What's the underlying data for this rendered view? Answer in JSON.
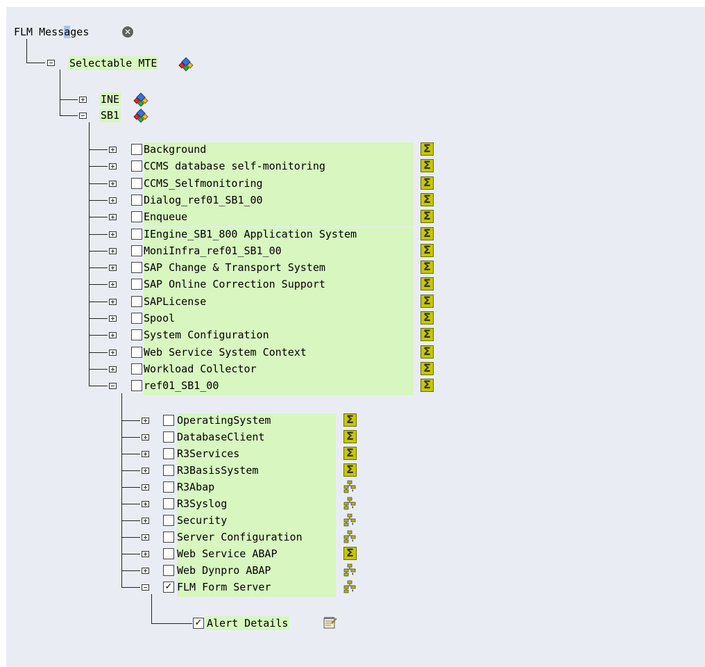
{
  "root": {
    "title_before": "FLM Mess",
    "title_sel": "a",
    "title_after": "ges"
  },
  "level1": {
    "label": "Selectable MTE"
  },
  "systems": [
    {
      "label": "INE"
    },
    {
      "label": "SB1"
    }
  ],
  "sb1_items": [
    {
      "label": "Background",
      "checked": false,
      "icon": "sigma-icon"
    },
    {
      "label": "CCMS database self-monitoring",
      "checked": false,
      "icon": "sigma-icon"
    },
    {
      "label": "CCMS_Selfmonitoring",
      "checked": false,
      "icon": "sigma-icon"
    },
    {
      "label": "Dialog_ref01_SB1_00",
      "checked": false,
      "icon": "sigma-icon"
    },
    {
      "label": "Enqueue",
      "checked": false,
      "icon": "sigma-icon"
    },
    {
      "label": "IEngine_SB1_800 Application System",
      "checked": false,
      "icon": "sigma-icon"
    },
    {
      "label": "MoniInfra_ref01_SB1_00",
      "checked": false,
      "icon": "sigma-icon"
    },
    {
      "label": "SAP Change & Transport System",
      "checked": false,
      "icon": "sigma-icon"
    },
    {
      "label": "SAP Online Correction Support",
      "checked": false,
      "icon": "sigma-icon"
    },
    {
      "label": "SAPLicense",
      "checked": false,
      "icon": "sigma-icon"
    },
    {
      "label": "Spool",
      "checked": false,
      "icon": "sigma-icon"
    },
    {
      "label": "System Configuration",
      "checked": false,
      "icon": "sigma-icon"
    },
    {
      "label": "Web Service System Context",
      "checked": false,
      "icon": "sigma-icon"
    },
    {
      "label": "Workload Collector",
      "checked": false,
      "icon": "sigma-icon"
    },
    {
      "label": "ref01_SB1_00",
      "checked": false,
      "icon": "sigma-icon"
    }
  ],
  "ref_items": [
    {
      "label": "OperatingSystem",
      "checked": false,
      "icon": "sigma-icon"
    },
    {
      "label": "DatabaseClient",
      "checked": false,
      "icon": "sigma-icon"
    },
    {
      "label": "R3Services",
      "checked": false,
      "icon": "sigma-icon"
    },
    {
      "label": "R3BasisSystem",
      "checked": false,
      "icon": "sigma-icon"
    },
    {
      "label": "R3Abap",
      "checked": false,
      "icon": "collection-tree-icon"
    },
    {
      "label": "R3Syslog",
      "checked": false,
      "icon": "collection-tree-icon"
    },
    {
      "label": "Security",
      "checked": false,
      "icon": "collection-tree-icon"
    },
    {
      "label": "Server Configuration",
      "checked": false,
      "icon": "collection-tree-icon"
    },
    {
      "label": "Web Service ABAP",
      "checked": false,
      "icon": "sigma-icon"
    },
    {
      "label": "Web Dynpro ABAP",
      "checked": false,
      "icon": "collection-tree-icon"
    },
    {
      "label": "FLM Form Server",
      "checked": true,
      "icon": "collection-tree-icon"
    }
  ],
  "alert": {
    "label": "Alert Details",
    "checked": true
  },
  "glyphs": {
    "checkmark": "✓",
    "sigma": "Σ",
    "close": "✕"
  },
  "colors": {
    "background": "#e9edf3",
    "highlight": "#d7f6c0",
    "sigma_fill": "#c5c800",
    "selection": "#a8c4e6"
  }
}
